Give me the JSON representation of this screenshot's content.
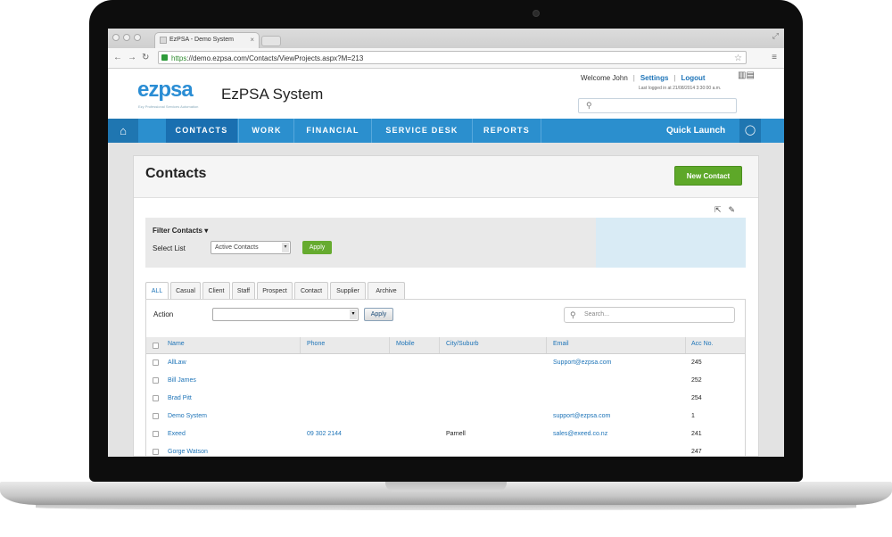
{
  "browser": {
    "tab_title": "EzPSA - Demo System",
    "url_https": "https",
    "url_rest": "://demo.ezpsa.com/Contacts/ViewProjects.aspx?M=213"
  },
  "app": {
    "logo_text": "ezpsa",
    "tagline": "Ezy Professional Services Automation",
    "system_title": "EzPSA System",
    "welcome": "Welcome John",
    "settings_link": "Settings",
    "logout_link": "Logout",
    "last_logged": "Last logged in at 21/08/2014 3:30:00 a.m."
  },
  "nav": {
    "items": [
      "CONTACTS",
      "WORK",
      "FINANCIAL",
      "SERVICE DESK",
      "REPORTS"
    ],
    "active_index": 0,
    "quick_launch": "Quick Launch"
  },
  "page": {
    "title": "Contacts",
    "new_button": "New Contact"
  },
  "filter": {
    "title": "Filter Contacts",
    "select_label": "Select List",
    "select_value": "Active Contacts",
    "apply_label": "Apply"
  },
  "tabs": [
    "ALL",
    "Casual",
    "Client",
    "Staff",
    "Prospect",
    "Contact",
    "Supplier",
    "Archive"
  ],
  "grid": {
    "action_label": "Action",
    "apply_label": "Apply",
    "search_placeholder": "Search...",
    "columns": [
      "Name",
      "Phone",
      "Mobile",
      "City/Suburb",
      "Email",
      "Acc No."
    ],
    "rows": [
      {
        "name": "AllLaw",
        "phone": "",
        "mobile": "",
        "city": "",
        "email": "Support@ezpsa.com",
        "acc": "245"
      },
      {
        "name": "Bill James",
        "phone": "",
        "mobile": "",
        "city": "",
        "email": "",
        "acc": "252"
      },
      {
        "name": "Brad Pitt",
        "phone": "",
        "mobile": "",
        "city": "",
        "email": "",
        "acc": "254"
      },
      {
        "name": "Demo System",
        "phone": "",
        "mobile": "",
        "city": "",
        "email": "support@ezpsa.com",
        "acc": "1"
      },
      {
        "name": "Exeed",
        "phone": "09 302 2144",
        "mobile": "",
        "city": "Parnell",
        "email": "sales@exeed.co.nz",
        "acc": "241"
      },
      {
        "name": "Gorge Watson",
        "phone": "",
        "mobile": "",
        "city": "",
        "email": "",
        "acc": "247"
      }
    ]
  },
  "colors": {
    "brand_blue": "#2b8fce",
    "nav_active": "#1a6fb0",
    "new_button_green": "#5ea829",
    "link_blue": "#1e74b8"
  }
}
